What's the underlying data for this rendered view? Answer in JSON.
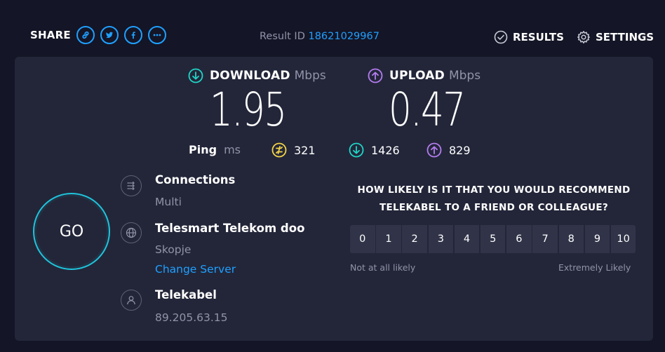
{
  "share": {
    "label": "SHARE",
    "buttons": [
      {
        "icon": "link-icon"
      },
      {
        "icon": "twitter-icon"
      },
      {
        "icon": "facebook-icon"
      },
      {
        "icon": "more-icon"
      }
    ]
  },
  "result": {
    "label": "Result ID",
    "id": "18621029967"
  },
  "nav": {
    "results": "RESULTS",
    "settings": "SETTINGS"
  },
  "download": {
    "title": "DOWNLOAD",
    "unit": "Mbps",
    "value": "1.95",
    "icon": "download-arrow-icon"
  },
  "upload": {
    "title": "UPLOAD",
    "unit": "Mbps",
    "value": "0.47",
    "icon": "upload-arrow-icon"
  },
  "ping": {
    "label": "Ping",
    "unit": "ms",
    "idle": "321",
    "download": "1426",
    "upload": "829"
  },
  "go": {
    "label": "GO"
  },
  "connections": {
    "title": "Connections",
    "value": "Multi"
  },
  "server": {
    "title": "Telesmart Telekom doo",
    "location": "Skopje",
    "change_label": "Change Server"
  },
  "isp": {
    "title": "Telekabel",
    "ip": "89.205.63.15"
  },
  "survey": {
    "question_line1": "HOW LIKELY IS IT THAT YOU WOULD RECOMMEND",
    "question_line2": "TELEKABEL TO A FRIEND OR COLLEAGUE?",
    "scale": [
      "0",
      "1",
      "2",
      "3",
      "4",
      "5",
      "6",
      "7",
      "8",
      "9",
      "10"
    ],
    "low_label": "Not at all likely",
    "high_label": "Extremely Likely"
  },
  "colors": {
    "background": "#141526",
    "panel": "#232639",
    "accent_blue": "#1fa0ff",
    "download_cyan": "#1fd6c8",
    "upload_purple": "#b47cf0",
    "ping_yellow": "#f5d547",
    "muted_text": "#9193a8"
  }
}
